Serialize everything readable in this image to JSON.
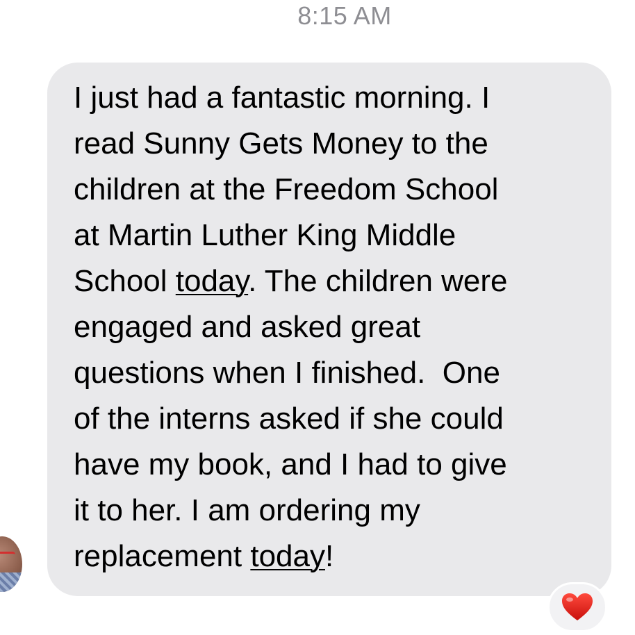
{
  "message": {
    "timestamp": "8:15 AM",
    "lines": [
      {
        "before": "I just had a fantastic morning. I",
        "link": "",
        "after": ""
      },
      {
        "before": "read Sunny Gets Money to the",
        "link": "",
        "after": ""
      },
      {
        "before": "children at the Freedom School",
        "link": "",
        "after": ""
      },
      {
        "before": "at Martin Luther King Middle",
        "link": "",
        "after": ""
      },
      {
        "before": "School ",
        "link": "today",
        "after": ". The children were"
      },
      {
        "before": "engaged and asked great",
        "link": "",
        "after": ""
      },
      {
        "before": "questions when I finished.  One",
        "link": "",
        "after": ""
      },
      {
        "before": "of the interns asked if she could",
        "link": "",
        "after": ""
      },
      {
        "before": "have my book, and I had to give",
        "link": "",
        "after": ""
      },
      {
        "before": "it to her. I am ordering my",
        "link": "",
        "after": ""
      },
      {
        "before": "replacement ",
        "link": "today",
        "after": "!"
      }
    ],
    "reaction_icon": "heart-icon",
    "reaction_color": "#e0201c",
    "bubble_color": "#e9e9eb",
    "timestamp_color": "#8e8e93"
  }
}
